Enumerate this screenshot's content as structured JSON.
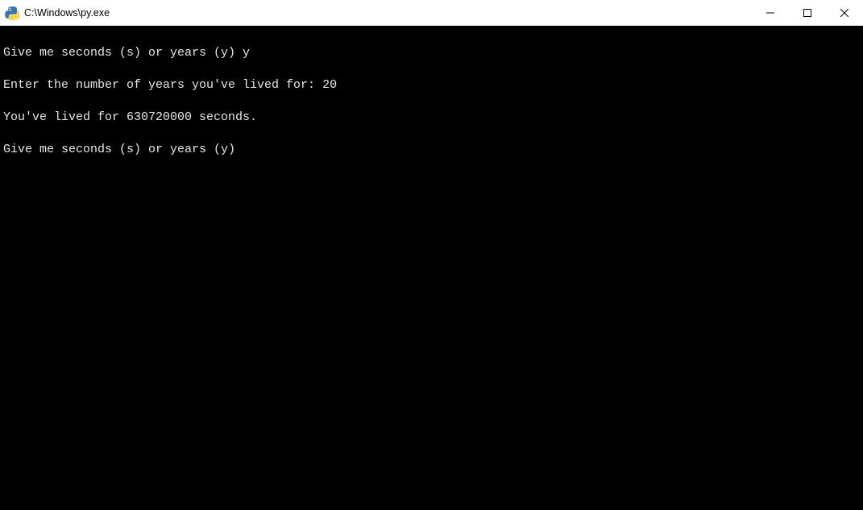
{
  "window": {
    "title": "C:\\Windows\\py.exe"
  },
  "console": {
    "line1": "Give me seconds (s) or years (y) y",
    "line2": "Enter the number of years you've lived for: 20",
    "line3": "You've lived for 630720000 seconds.",
    "line4": "Give me seconds (s) or years (y)"
  }
}
